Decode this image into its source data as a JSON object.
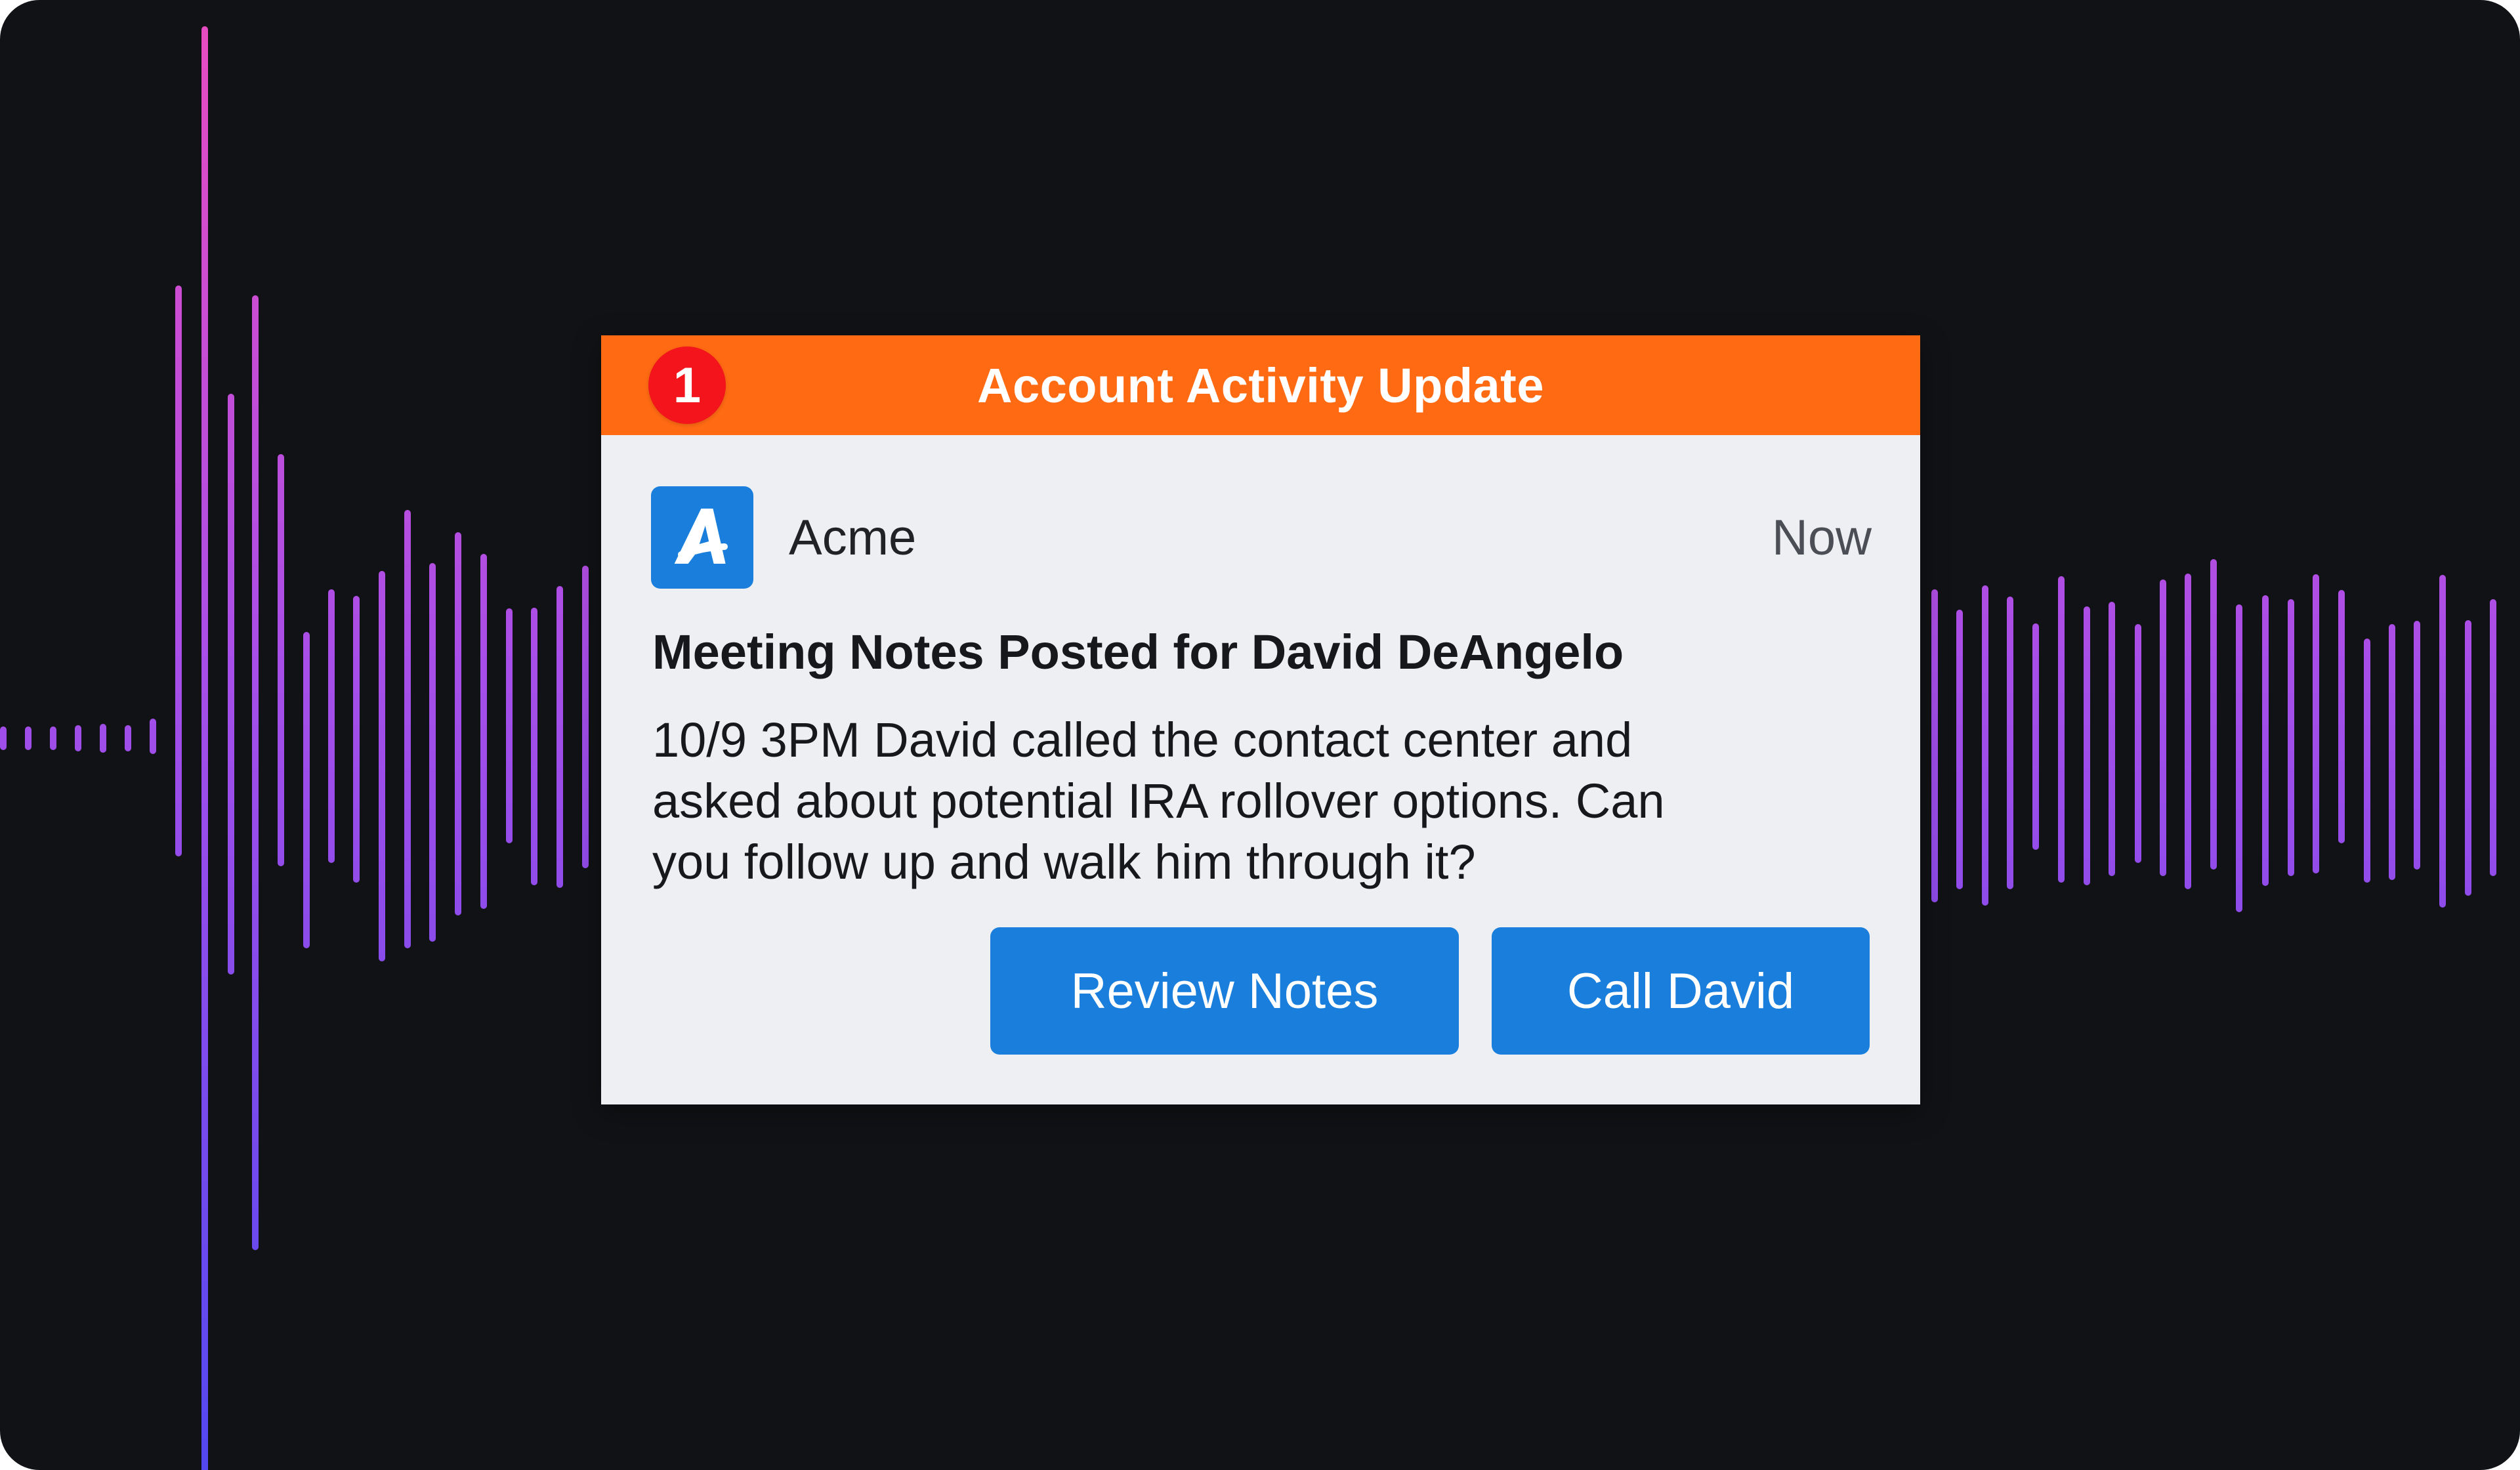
{
  "theme": {
    "background": "#111215",
    "header_color": "#ff6a13",
    "badge_color": "#f3141c",
    "accent": "#1a7fdc",
    "wave_gradient_top": "#e050c8",
    "wave_gradient_bottom": "#5a4fee"
  },
  "notification": {
    "header_title": "Account Activity Update",
    "badge_count": "1",
    "app": {
      "icon": "acme-logo-icon",
      "name": "Acme",
      "time": "Now"
    },
    "title": "Meeting Notes Posted for David DeAngelo",
    "body_lines": [
      "10/9 3PM David called the contact center and",
      "asked about potential IRA rollover options. Can",
      "you follow up and walk him through it?"
    ],
    "actions": {
      "review_label": "Review Notes",
      "call_label": "Call David"
    }
  },
  "decor": {
    "waveform_icon": "audio-waveform-decoration"
  }
}
